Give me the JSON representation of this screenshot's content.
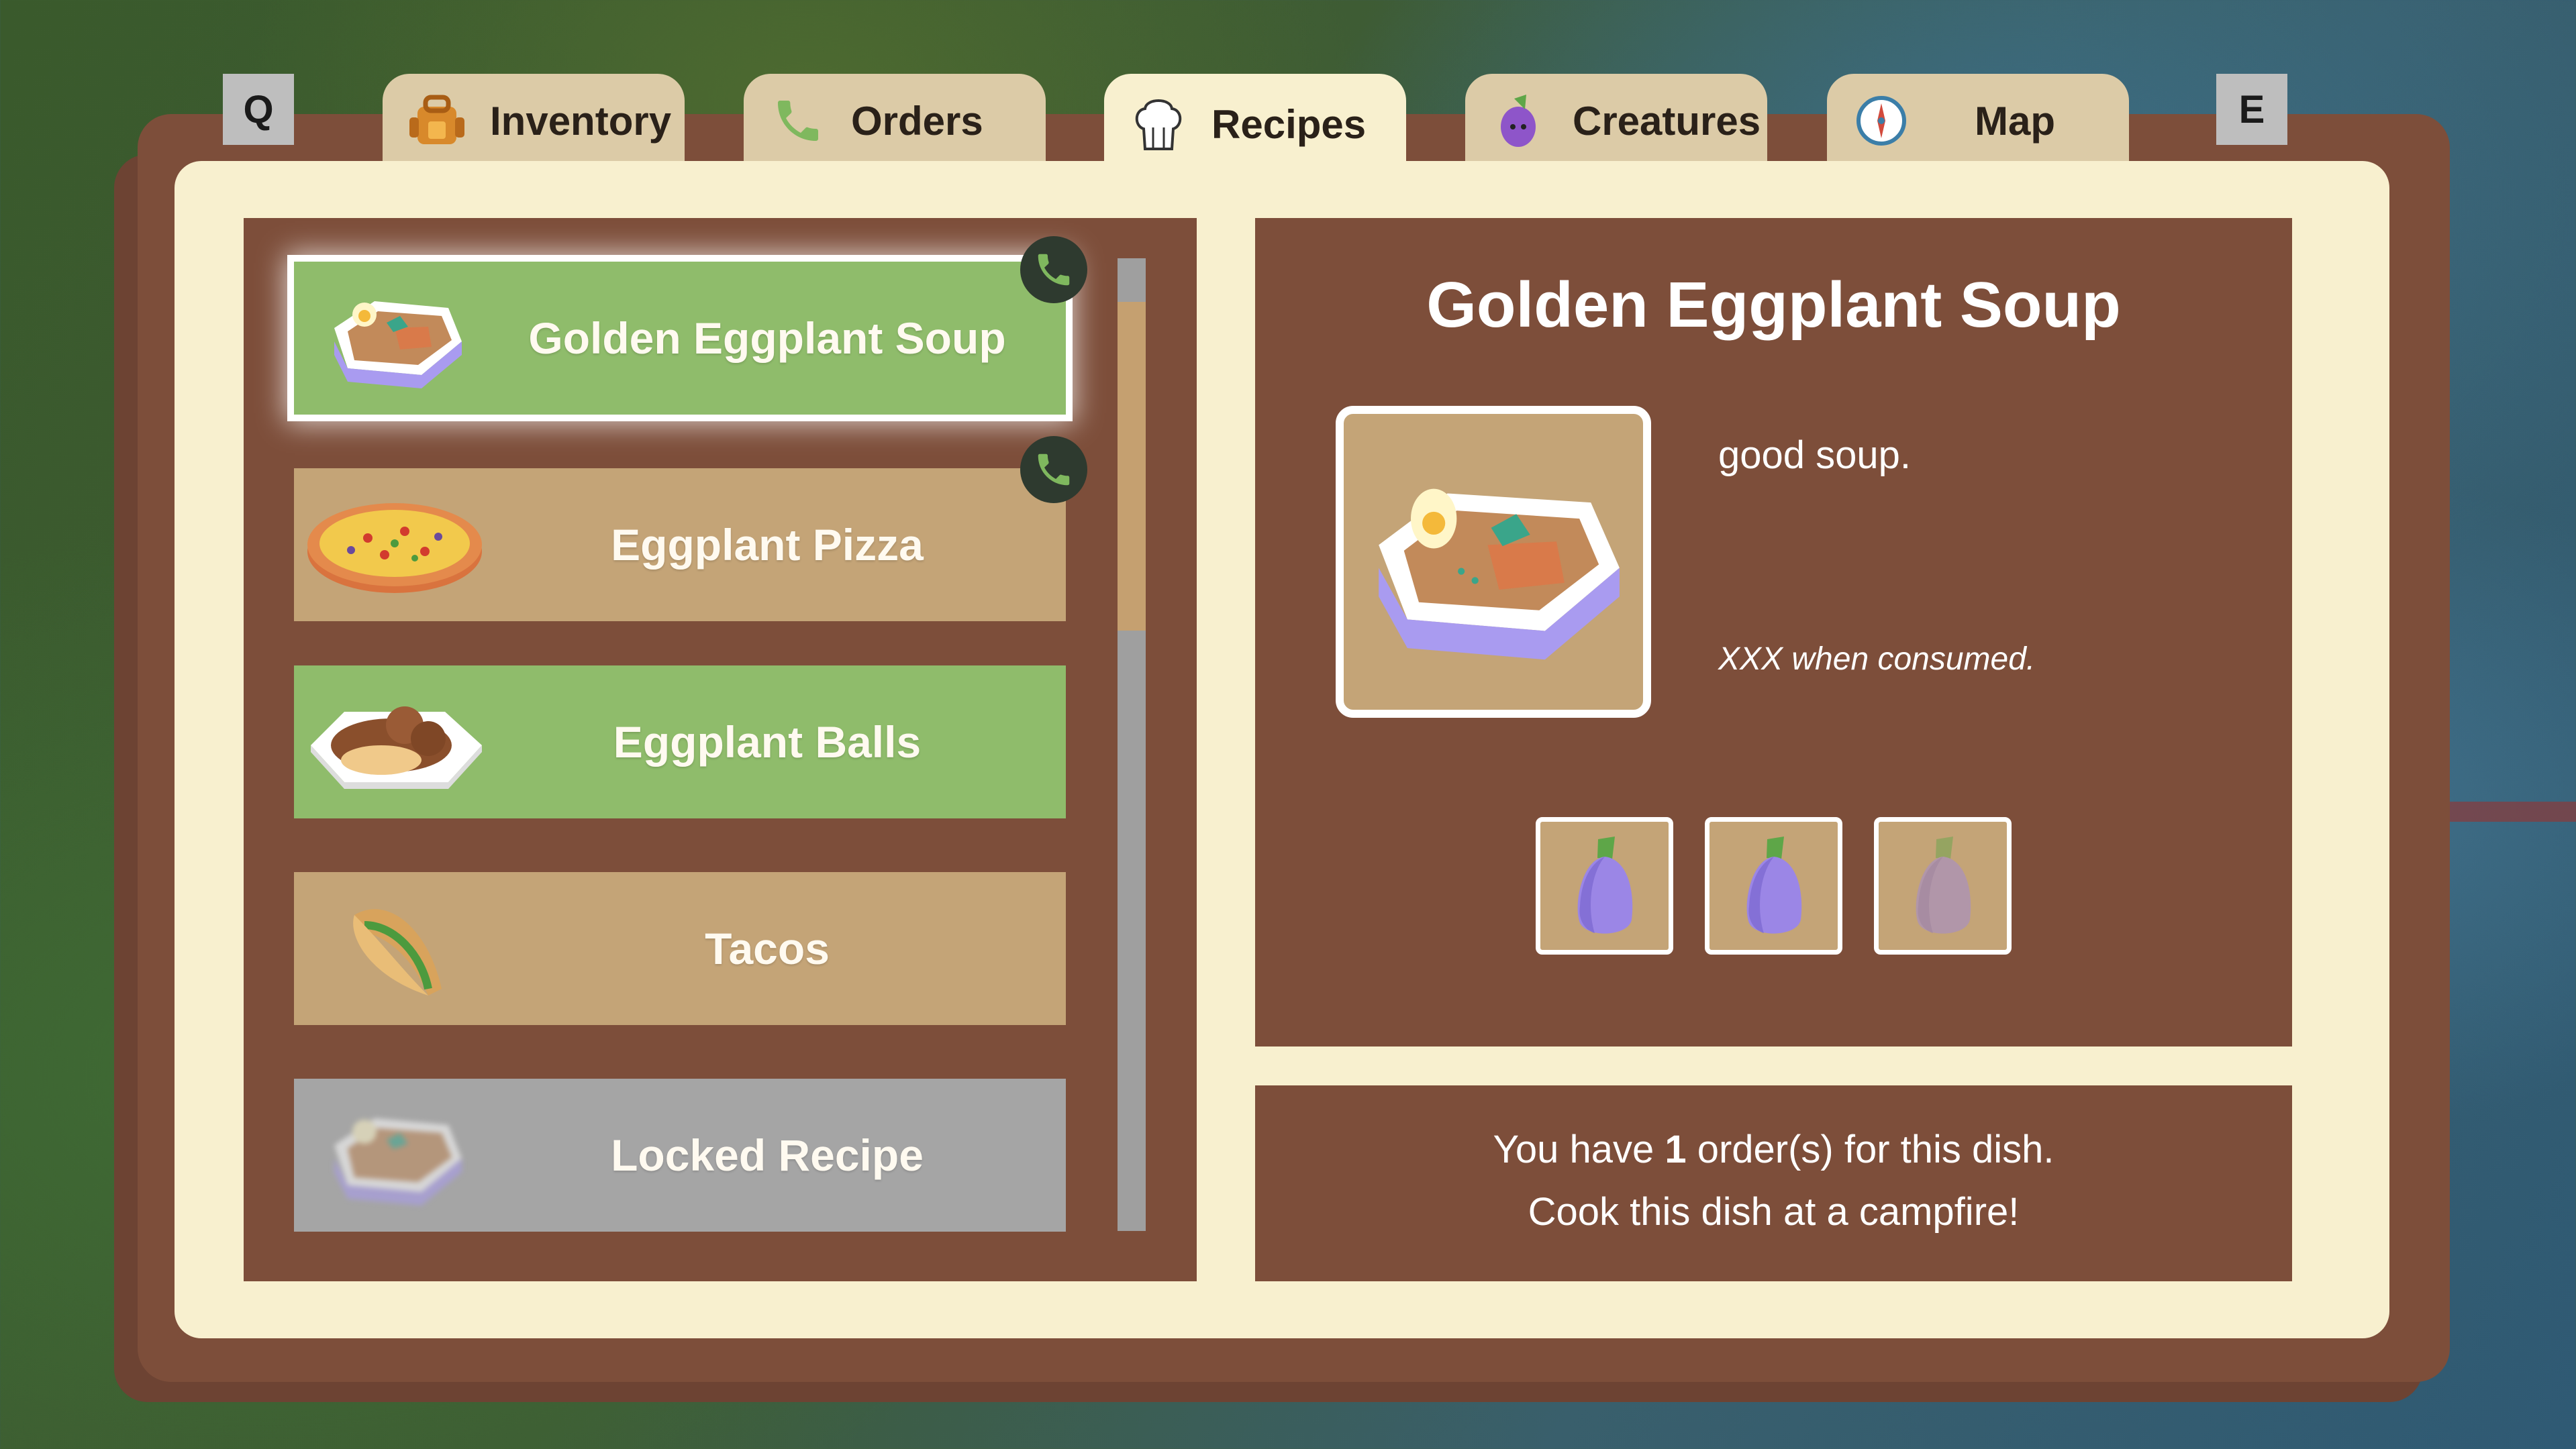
{
  "keys": {
    "left": "Q",
    "right": "E"
  },
  "tabs": [
    {
      "label": "Inventory",
      "icon": "backpack-icon",
      "active": false
    },
    {
      "label": "Orders",
      "icon": "phone-icon",
      "active": false
    },
    {
      "label": "Recipes",
      "icon": "chef-hat-icon",
      "active": true
    },
    {
      "label": "Creatures",
      "icon": "eggplant-icon",
      "active": false
    },
    {
      "label": "Map",
      "icon": "compass-icon",
      "active": false
    }
  ],
  "recipes": [
    {
      "label": "Golden Eggplant Soup",
      "icon": "soup-bowl-icon",
      "state": "available",
      "selected": true,
      "has_order": true
    },
    {
      "label": "Eggplant Pizza",
      "icon": "pizza-icon",
      "state": "unavailable",
      "selected": false,
      "has_order": true
    },
    {
      "label": "Eggplant Balls",
      "icon": "eggplant-balls-plate-icon",
      "state": "available",
      "selected": false,
      "has_order": false
    },
    {
      "label": "Tacos",
      "icon": "taco-icon",
      "state": "unavailable",
      "selected": false,
      "has_order": false
    },
    {
      "label": "Locked Recipe",
      "icon": "soup-bowl-icon",
      "state": "locked",
      "selected": false,
      "has_order": false
    }
  ],
  "detail": {
    "title": "Golden Eggplant Soup",
    "description": "good soup.",
    "effect": "XXX when consumed.",
    "ingredients": [
      {
        "icon": "eggplant-icon",
        "owned": true
      },
      {
        "icon": "eggplant-icon",
        "owned": true
      },
      {
        "icon": "eggplant-icon",
        "owned": false
      }
    ]
  },
  "orders": {
    "prefix": "You have ",
    "count": "1",
    "suffix": " order(s) for this dish.",
    "instruction": "Cook this dish at a campfire!"
  },
  "colors": {
    "available": "#8fbc6b",
    "unavailable": "#c4a477",
    "locked": "#a5a5a5",
    "panel": "#7d4e3a",
    "paper": "#f8f0cf"
  }
}
